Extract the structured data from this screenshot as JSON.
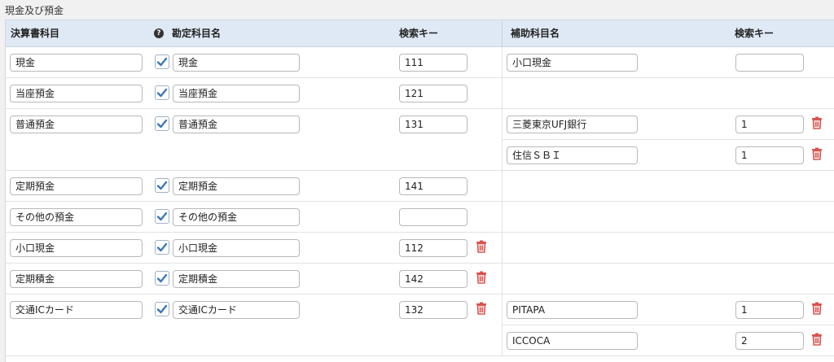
{
  "section_title": "現金及び預金",
  "headers": {
    "account": "決算書科目",
    "help_icon": "?",
    "name": "勘定科目名",
    "key": "検索キー",
    "sub_name": "補助科目名",
    "sub_key": "検索キー"
  },
  "colors": {
    "header_bg": "#dfe9f5",
    "check": "#3b78b9",
    "trash": "#d9534f"
  },
  "rows": [
    {
      "account": "現金",
      "checked": true,
      "name": "現金",
      "key": "111",
      "deletable": false,
      "subs": [
        {
          "name": "小口現金",
          "key": "",
          "deletable": false
        }
      ]
    },
    {
      "account": "当座預金",
      "checked": true,
      "name": "当座預金",
      "key": "121",
      "deletable": false,
      "subs": []
    },
    {
      "account": "普通預金",
      "checked": true,
      "name": "普通預金",
      "key": "131",
      "deletable": false,
      "subs": [
        {
          "name": "三菱東京UFJ銀行",
          "key": "1",
          "deletable": true
        },
        {
          "name": "住信ＳＢＩ",
          "key": "1",
          "deletable": true
        }
      ]
    },
    {
      "account": "定期預金",
      "checked": true,
      "name": "定期預金",
      "key": "141",
      "deletable": false,
      "subs": []
    },
    {
      "account": "その他の預金",
      "checked": true,
      "name": "その他の預金",
      "key": "",
      "deletable": false,
      "subs": []
    },
    {
      "account": "小口現金",
      "checked": true,
      "name": "小口現金",
      "key": "112",
      "deletable": true,
      "subs": []
    },
    {
      "account": "定期積金",
      "checked": true,
      "name": "定期積金",
      "key": "142",
      "deletable": true,
      "subs": []
    },
    {
      "account": "交通ICカード",
      "checked": true,
      "name": "交通ICカード",
      "key": "132",
      "deletable": true,
      "subs": [
        {
          "name": "PITAPA",
          "key": "1",
          "deletable": true
        },
        {
          "name": "ICCOCA",
          "key": "2",
          "deletable": true
        }
      ]
    }
  ]
}
